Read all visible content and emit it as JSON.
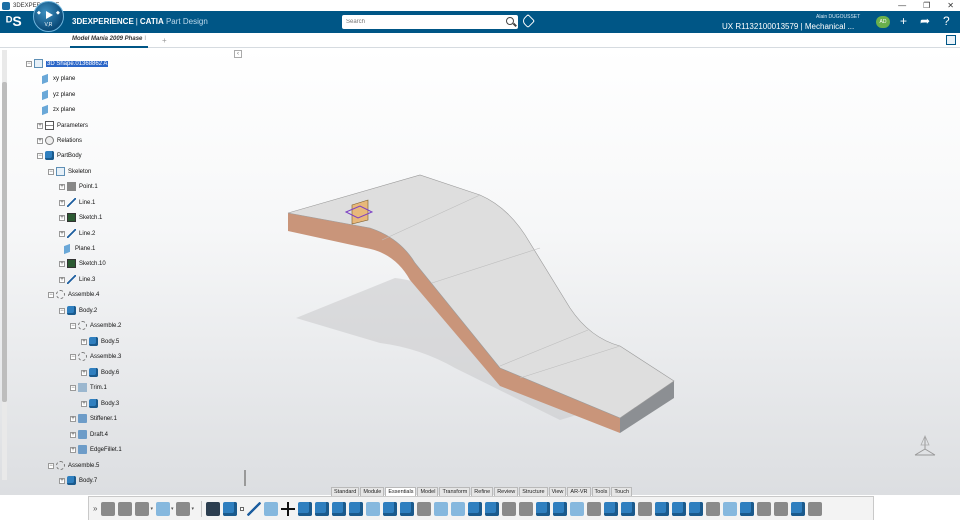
{
  "os": {
    "title": "3DEXPERIENCE",
    "controls": [
      "—",
      "❐",
      "✕"
    ]
  },
  "header": {
    "brand_bold": "3DEXPERIENCE",
    "brand_sep": "|",
    "brand_product": "CATIA",
    "app_name": "Part Design",
    "compass_label": "V,R",
    "search_placeholder": "Search",
    "user_name": "Alain DUGOUSSET",
    "context": "UX R1132100013579 | Mechanical ...",
    "avatar_text": "AD",
    "add_symbol": "+",
    "share_symbol": "➦",
    "help_symbol": "?"
  },
  "tabbar": {
    "tab_label": "Model Mania 2009 Phase",
    "tab_close": "I",
    "add_label": "+"
  },
  "tree": {
    "collapse_symbol": "‹",
    "nodes": [
      {
        "label": "3D Shape.01368862 A",
        "selected": true
      },
      {
        "label": "xy plane"
      },
      {
        "label": "yz plane"
      },
      {
        "label": "zx plane"
      },
      {
        "label": "Parameters"
      },
      {
        "label": "Relations"
      },
      {
        "label": "PartBody"
      },
      {
        "label": "Skeleton"
      },
      {
        "label": "Point.1"
      },
      {
        "label": "Line.1"
      },
      {
        "label": "Sketch.1"
      },
      {
        "label": "Line.2"
      },
      {
        "label": "Plane.1"
      },
      {
        "label": "Sketch.10"
      },
      {
        "label": "Line.3"
      },
      {
        "label": "Assemble.4"
      },
      {
        "label": "Body.2"
      },
      {
        "label": "Assemble.2"
      },
      {
        "label": "Body.5"
      },
      {
        "label": "Assemble.3"
      },
      {
        "label": "Body.6"
      },
      {
        "label": "Trim.1"
      },
      {
        "label": "Body.3"
      },
      {
        "label": "Stiffener.1"
      },
      {
        "label": "Draft.4"
      },
      {
        "label": "EdgeFillet.1"
      },
      {
        "label": "Assemble.5"
      },
      {
        "label": "Body.7"
      }
    ]
  },
  "section_tabs": [
    "Standard",
    "Module",
    "Essentials",
    "Model",
    "Transform",
    "Refine",
    "Review",
    "Structure",
    "View",
    "AR-VR",
    "Tools",
    "Touch"
  ],
  "active_section": "Essentials",
  "toolbar": {
    "more_symbol": "»",
    "dropdown_symbol": "▾"
  },
  "colors": {
    "header_blue": "#005686",
    "selection": "#2b66c8",
    "part_top": "#dcdcdc",
    "part_side": "#c9957a"
  }
}
